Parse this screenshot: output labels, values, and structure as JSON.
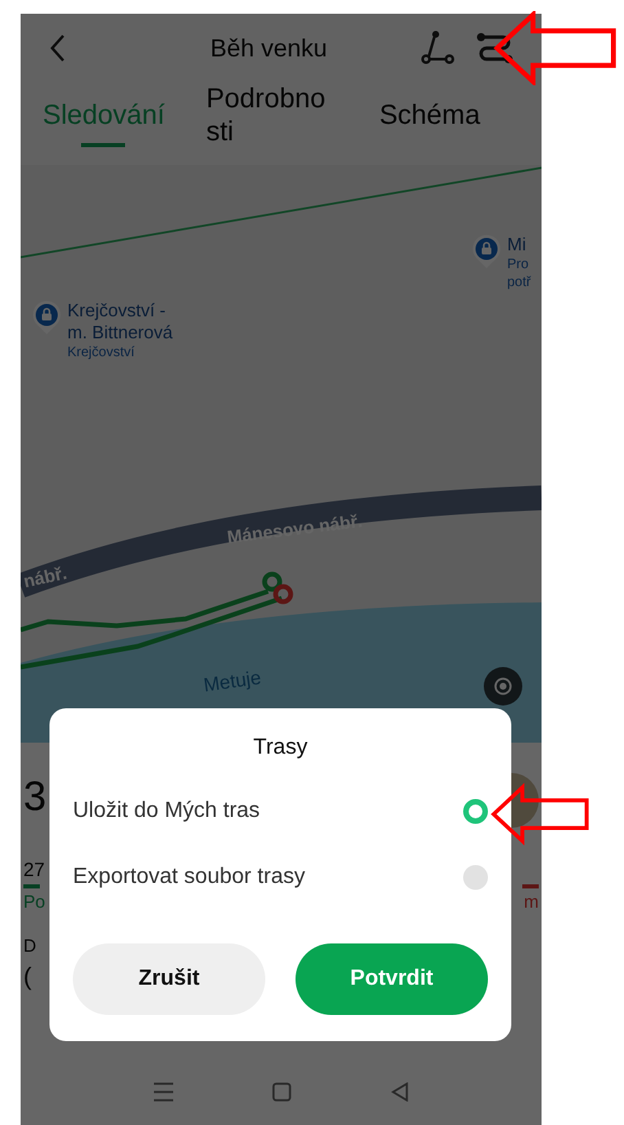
{
  "header": {
    "title": "Běh venku"
  },
  "tabs": [
    {
      "label": "Sledování",
      "selected": true
    },
    {
      "label": "Podrobnosti",
      "selected": false
    },
    {
      "label": "Schéma",
      "selected": false
    }
  ],
  "map": {
    "pois": [
      {
        "name_lines": [
          "Krejčovství -",
          "m. Bittnerová"
        ],
        "category_lines": [
          "Krejčovství"
        ]
      },
      {
        "name_lines": [
          "Mi"
        ],
        "category_lines": [
          "Pro",
          "potř"
        ]
      }
    ],
    "street_labels": [
      "Mánesovo nábř.",
      "nábř."
    ],
    "river_label": "Metuje"
  },
  "stats": {
    "big_value": "3",
    "small_value": "27",
    "left_label": "Po",
    "right_label": "m",
    "row_label": "D",
    "row_value": "("
  },
  "dialog": {
    "title": "Trasy",
    "options": [
      {
        "label": "Uložit do Mých tras",
        "selected": true
      },
      {
        "label": "Exportovat soubor trasy",
        "selected": false
      }
    ],
    "buttons": [
      {
        "label": "Zrušit",
        "kind": "cancel"
      },
      {
        "label": "Potvrdit",
        "kind": "confirm"
      }
    ]
  }
}
